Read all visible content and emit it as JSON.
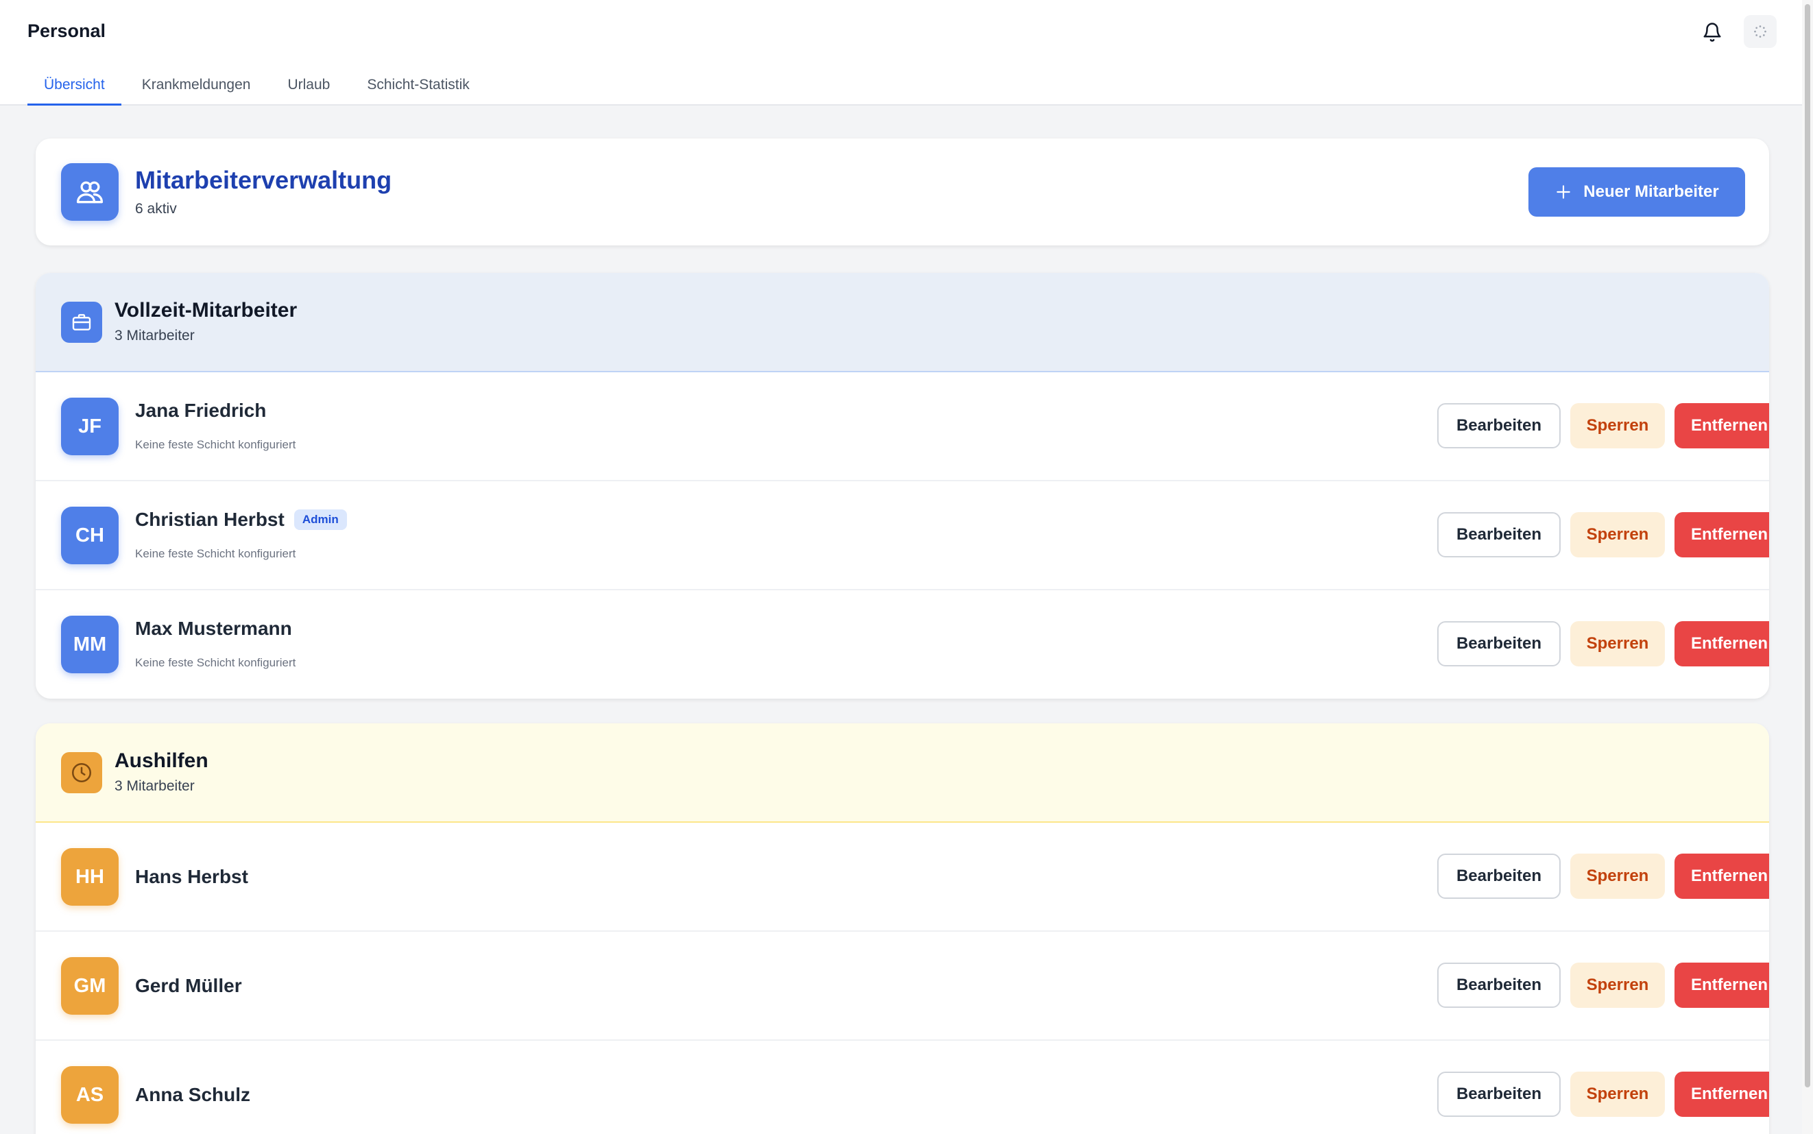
{
  "header": {
    "title": "Personal",
    "tabs": [
      "Übersicht",
      "Krankmeldungen",
      "Urlaub",
      "Schicht-Statistik"
    ],
    "active_tab": "Übersicht"
  },
  "summary": {
    "title": "Mitarbeiterverwaltung",
    "subtitle": "6 aktiv",
    "new_button": "Neuer Mitarbeiter"
  },
  "actions": {
    "edit": "Bearbeiten",
    "lock": "Sperren",
    "remove": "Entfernen"
  },
  "groups": [
    {
      "title": "Vollzeit-Mitarbeiter",
      "count": "3 Mitarbeiter",
      "employees": [
        {
          "initials": "JF",
          "name": "Jana Friedrich",
          "shift": "Keine feste Schicht konfiguriert"
        },
        {
          "initials": "CH",
          "name": "Christian Herbst",
          "badge": "Admin",
          "shift": "Keine feste Schicht konfiguriert"
        },
        {
          "initials": "MM",
          "name": "Max Mustermann",
          "shift": "Keine feste Schicht konfiguriert"
        }
      ]
    },
    {
      "title": "Aushilfen",
      "count": "3 Mitarbeiter",
      "employees": [
        {
          "initials": "HH",
          "name": "Hans Herbst"
        },
        {
          "initials": "GM",
          "name": "Gerd Müller"
        },
        {
          "initials": "AS",
          "name": "Anna Schulz"
        }
      ]
    }
  ],
  "colors": {
    "primary": "#4f7fe8",
    "aushilfe": "#eda43c",
    "danger": "#e94545",
    "warning_bg": "#fdefd8",
    "title_blue": "#1e40af"
  },
  "icons": {
    "notifications": "bell-icon",
    "loading": "spinner-icon",
    "summary": "users-icon",
    "fulltime": "briefcase-icon",
    "parttime": "clock-icon",
    "add": "plus-icon"
  }
}
